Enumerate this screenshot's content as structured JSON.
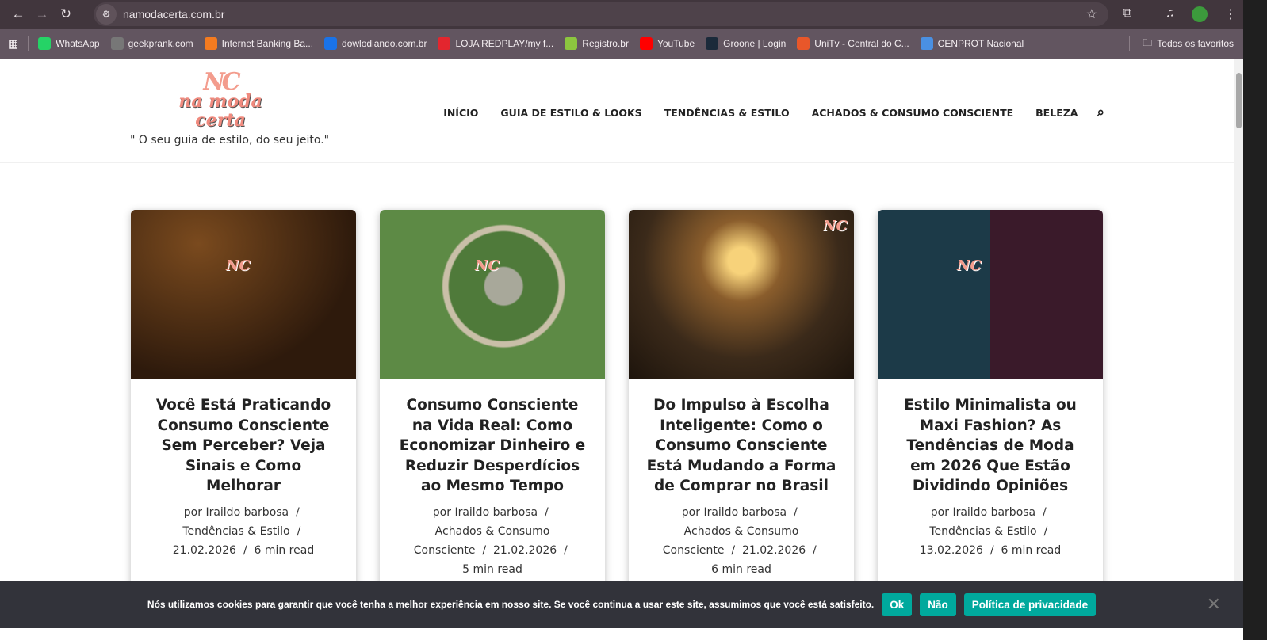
{
  "browser": {
    "url": "namodacerta.com.br",
    "bookmarks": [
      "WhatsApp",
      "geekprank.com",
      "Internet Banking Ba...",
      "dowlodiando.com.br",
      "LOJA REDPLAY/my f...",
      "Registro.br",
      "YouTube",
      "Groone | Login",
      "UniTv - Central do C...",
      "CENPROT Nacional"
    ],
    "all_bookmarks": "Todos os favoritos",
    "bookmark_colors": [
      "#25d366",
      "#777",
      "#f47b20",
      "#1a73e8",
      "#e3262e",
      "#8cc63f",
      "#ff0000",
      "#1b2a3a",
      "#e8572a",
      "#4a90e2"
    ]
  },
  "site": {
    "logo_text": "NC na moda certa",
    "tagline": "\" O seu guia de estilo, do seu jeito.\"",
    "menu": [
      "INÍCIO",
      "GUIA DE ESTILO & LOOKS",
      "TENDÊNCIAS & ESTILO",
      "ACHADOS & CONSUMO CONSCIENTE",
      "BELEZA"
    ]
  },
  "posts": [
    {
      "title": "Você Está Praticando Consumo Consciente Sem Perceber? Veja Sinais e Como Melhorar",
      "author": "por Iraildo barbosa",
      "category": "Tendências & Estilo",
      "date": "21.02.2026",
      "read": "6 min read"
    },
    {
      "title": "Consumo Consciente na Vida Real: Como Economizar Dinheiro e Reduzir Desperdícios ao Mesmo Tempo",
      "author": "por Iraildo barbosa",
      "category": "Achados & Consumo Consciente",
      "date": "21.02.2026",
      "read": "5 min read"
    },
    {
      "title": "Do Impulso à Escolha Inteligente: Como o Consumo Consciente Está Mudando a Forma de Comprar no Brasil",
      "author": "por Iraildo barbosa",
      "category": "Achados & Consumo Consciente",
      "date": "21.02.2026",
      "read": "6 min read"
    },
    {
      "title": "Estilo Minimalista ou Maxi Fashion? As Tendências de Moda em 2026 Que Estão Dividindo Opiniões",
      "author": "por Iraildo barbosa",
      "category": "Tendências & Estilo",
      "date": "13.02.2026",
      "read": "6 min read"
    }
  ],
  "cookie": {
    "text": "Nós utilizamos cookies para garantir que você tenha a melhor experiência em nosso site. Se você continua a usar este site, assumimos que você está satisfeito.",
    "ok": "Ok",
    "no": "Não",
    "policy": "Política de privacidade",
    "accent": "#00a99d"
  }
}
